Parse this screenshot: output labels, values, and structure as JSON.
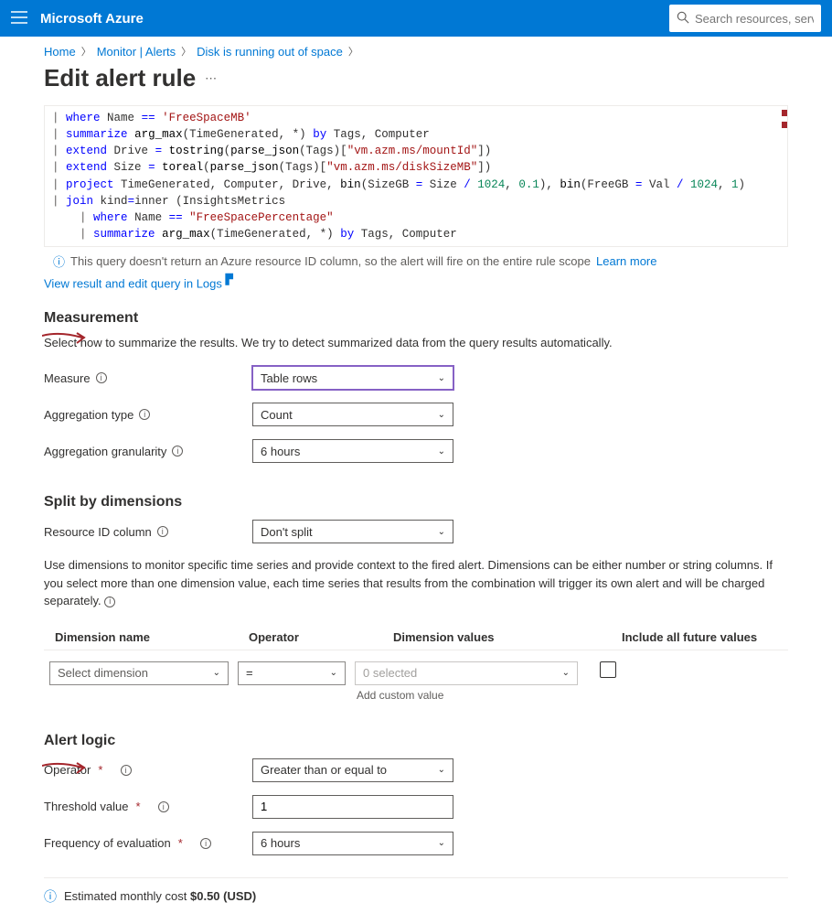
{
  "header": {
    "brand": "Microsoft Azure",
    "search_placeholder": "Search resources, services"
  },
  "breadcrumbs": {
    "items": [
      "Home",
      "Monitor | Alerts",
      "Disk is running out of space"
    ]
  },
  "page": {
    "title": "Edit alert rule"
  },
  "query": {
    "lines": [
      "| where Name == 'FreeSpaceMB'",
      "| summarize arg_max(TimeGenerated, *) by Tags, Computer",
      "| extend Drive = tostring(parse_json(Tags)[\"vm.azm.ms/mountId\"])",
      "| extend Size = toreal(parse_json(Tags)[\"vm.azm.ms/diskSizeMB\"])",
      "| project TimeGenerated, Computer, Drive, bin(SizeGB = Size / 1024, 0.1), bin(FreeGB = Val / 1024, 1)",
      "| join kind=inner (InsightsMetrics",
      "    | where Name == \"FreeSpacePercentage\"",
      "    | summarize arg_max(TimeGenerated, *) by Tags, Computer"
    ],
    "note_prefix": "This query doesn't return an Azure resource ID column, so the alert will fire on the entire rule scope",
    "learn_more": "Learn more",
    "view_link": "View result and edit query in Logs"
  },
  "measurement": {
    "heading": "Measurement",
    "desc": "Select how to summarize the results. We try to detect summarized data from the query results automatically.",
    "measure_label": "Measure",
    "measure_value": "Table rows",
    "agg_type_label": "Aggregation type",
    "agg_type_value": "Count",
    "agg_gran_label": "Aggregation granularity",
    "agg_gran_value": "6 hours"
  },
  "split": {
    "heading": "Split by dimensions",
    "resid_label": "Resource ID column",
    "resid_value": "Don't split",
    "hint": "Use dimensions to monitor specific time series and provide context to the fired alert. Dimensions can be either number or string columns. If you select more than one dimension value, each time series that results from the combination will trigger its own alert and will be charged separately.",
    "col_dim": "Dimension name",
    "col_op": "Operator",
    "col_val": "Dimension values",
    "col_future": "Include all future values",
    "dim_placeholder": "Select dimension",
    "op_value": "=",
    "val_placeholder": "0 selected",
    "add_custom": "Add custom value"
  },
  "logic": {
    "heading": "Alert logic",
    "operator_label": "Operator",
    "operator_value": "Greater than or equal to",
    "threshold_label": "Threshold value",
    "threshold_value": "1",
    "freq_label": "Frequency of evaluation",
    "freq_value": "6 hours"
  },
  "cost": {
    "label_prefix": "Estimated monthly cost ",
    "value": "$0.50 (USD)"
  }
}
